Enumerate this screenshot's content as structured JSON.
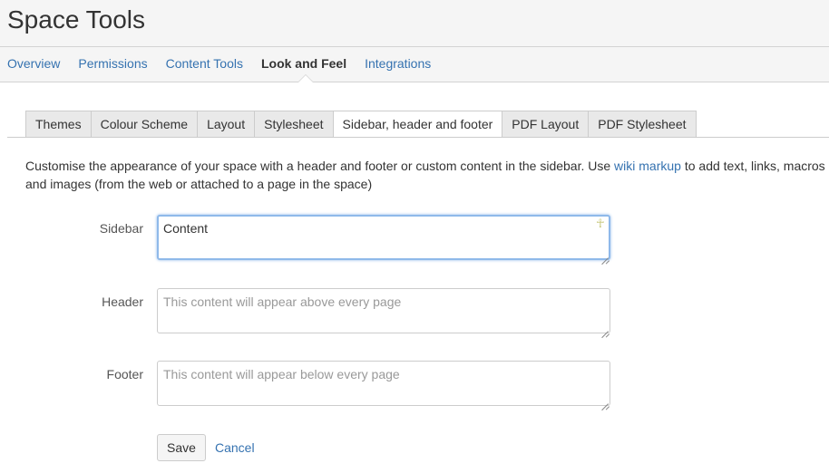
{
  "page": {
    "title": "Space Tools"
  },
  "nav": {
    "items": [
      {
        "label": "Overview",
        "active": false
      },
      {
        "label": "Permissions",
        "active": false
      },
      {
        "label": "Content Tools",
        "active": false
      },
      {
        "label": "Look and Feel",
        "active": true
      },
      {
        "label": "Integrations",
        "active": false
      }
    ]
  },
  "tabs": [
    {
      "label": "Themes",
      "active": false
    },
    {
      "label": "Colour Scheme",
      "active": false
    },
    {
      "label": "Layout",
      "active": false
    },
    {
      "label": "Stylesheet",
      "active": false
    },
    {
      "label": "Sidebar, header and footer",
      "active": true
    },
    {
      "label": "PDF Layout",
      "active": false
    },
    {
      "label": "PDF Stylesheet",
      "active": false
    }
  ],
  "description": {
    "before_link": "Customise the appearance of your space with a header and footer or custom content in the sidebar. Use ",
    "link": "wiki markup",
    "after_link": " to add text, links, macros and images (from the web or attached to a page in the space)"
  },
  "form": {
    "sidebar": {
      "label": "Sidebar",
      "value": "Content",
      "placeholder": ""
    },
    "header": {
      "label": "Header",
      "value": "",
      "placeholder": "This content will appear above every page"
    },
    "footer": {
      "label": "Footer",
      "value": "",
      "placeholder": "This content will appear below every page"
    },
    "save_label": "Save",
    "cancel_label": "Cancel"
  },
  "icons": {
    "sidebar_field_marker": "ankh-icon"
  },
  "colors": {
    "link": "#3572b0",
    "focus": "#8fb9ea",
    "header_bg": "#f5f5f5"
  }
}
